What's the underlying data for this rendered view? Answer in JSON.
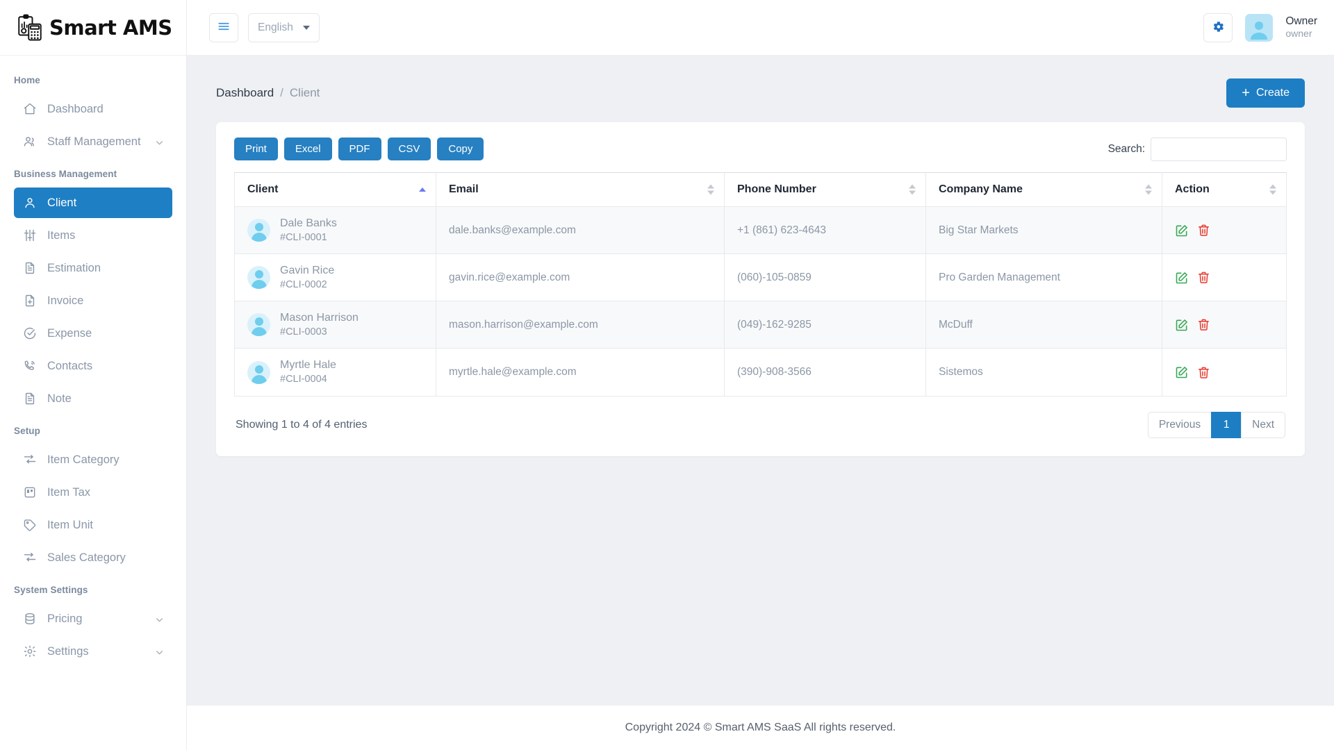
{
  "brand": {
    "name": "Smart AMS",
    "logo_icon": "clipboard-calculator-icon"
  },
  "sidebar": {
    "sections": [
      {
        "title": "Home",
        "items": [
          {
            "label": "Dashboard",
            "icon": "home-icon",
            "active": false,
            "has_caret": false
          },
          {
            "label": "Staff Management",
            "icon": "users-icon",
            "active": false,
            "has_caret": true
          }
        ]
      },
      {
        "title": "Business Management",
        "items": [
          {
            "label": "Client",
            "icon": "user-icon",
            "active": true,
            "has_caret": false
          },
          {
            "label": "Items",
            "icon": "sliders-icon",
            "active": false,
            "has_caret": false
          },
          {
            "label": "Estimation",
            "icon": "file-text-icon",
            "active": false,
            "has_caret": false
          },
          {
            "label": "Invoice",
            "icon": "file-plus-icon",
            "active": false,
            "has_caret": false
          },
          {
            "label": "Expense",
            "icon": "check-circle-icon",
            "active": false,
            "has_caret": false
          },
          {
            "label": "Contacts",
            "icon": "phone-icon",
            "active": false,
            "has_caret": false
          },
          {
            "label": "Note",
            "icon": "file-text-icon",
            "active": false,
            "has_caret": false
          }
        ]
      },
      {
        "title": "Setup",
        "items": [
          {
            "label": "Item Category",
            "icon": "filter-lines-icon",
            "active": false,
            "has_caret": false
          },
          {
            "label": "Item Tax",
            "icon": "trello-icon",
            "active": false,
            "has_caret": false
          },
          {
            "label": "Item Unit",
            "icon": "tag-icon",
            "active": false,
            "has_caret": false
          },
          {
            "label": "Sales Category",
            "icon": "filter-lines-icon",
            "active": false,
            "has_caret": false
          }
        ]
      },
      {
        "title": "System Settings",
        "items": [
          {
            "label": "Pricing",
            "icon": "database-icon",
            "active": false,
            "has_caret": true
          },
          {
            "label": "Settings",
            "icon": "gear-icon",
            "active": false,
            "has_caret": true
          }
        ]
      }
    ]
  },
  "topbar": {
    "menu_toggle_icon": "hamburger-icon",
    "language": "English",
    "settings_icon": "gear-icon",
    "user": {
      "name": "Owner",
      "role": "owner",
      "avatar_icon": "user-avatar-icon"
    }
  },
  "page": {
    "breadcrumb": {
      "parent": "Dashboard",
      "separator": "/",
      "current": "Client"
    },
    "create_button": {
      "label": "Create",
      "icon": "plus-icon"
    }
  },
  "toolbar": {
    "export_buttons": [
      "Print",
      "Excel",
      "PDF",
      "CSV",
      "Copy"
    ],
    "search_label": "Search:",
    "search_value": "",
    "search_placeholder": ""
  },
  "table": {
    "columns": [
      {
        "label": "Client",
        "sort": "asc"
      },
      {
        "label": "Email",
        "sort": "none"
      },
      {
        "label": "Phone Number",
        "sort": "none"
      },
      {
        "label": "Company Name",
        "sort": "none"
      },
      {
        "label": "Action",
        "sort": "none"
      }
    ],
    "rows": [
      {
        "name": "Dale Banks",
        "client_id": "#CLI-0001",
        "email": "dale.banks@example.com",
        "phone": "+1 (861) 623-4643",
        "company": "Big Star Markets"
      },
      {
        "name": "Gavin Rice",
        "client_id": "#CLI-0002",
        "email": "gavin.rice@example.com",
        "phone": "(060)-105-0859",
        "company": "Pro Garden Management"
      },
      {
        "name": "Mason Harrison",
        "client_id": "#CLI-0003",
        "email": "mason.harrison@example.com",
        "phone": "(049)-162-9285",
        "company": "McDuff"
      },
      {
        "name": "Myrtle Hale",
        "client_id": "#CLI-0004",
        "email": "myrtle.hale@example.com",
        "phone": "(390)-908-3566",
        "company": "Sistemos"
      }
    ],
    "row_actions": {
      "edit_icon": "edit-pencil-icon",
      "delete_icon": "trash-icon"
    }
  },
  "pagination": {
    "entries_info": "Showing 1 to 4 of 4 entries",
    "previous_label": "Previous",
    "next_label": "Next",
    "pages": [
      "1"
    ],
    "current_page": "1"
  },
  "footer": {
    "copyright": "Copyright 2024 © Smart AMS SaaS All rights reserved."
  },
  "colors": {
    "accent_blue": "#1d7ec4",
    "export_blue": "#2680c2",
    "edit_green": "#34a853",
    "delete_red": "#e8372c",
    "avatar_blue": "#6fcdee",
    "sort_active": "#6d79f0"
  }
}
